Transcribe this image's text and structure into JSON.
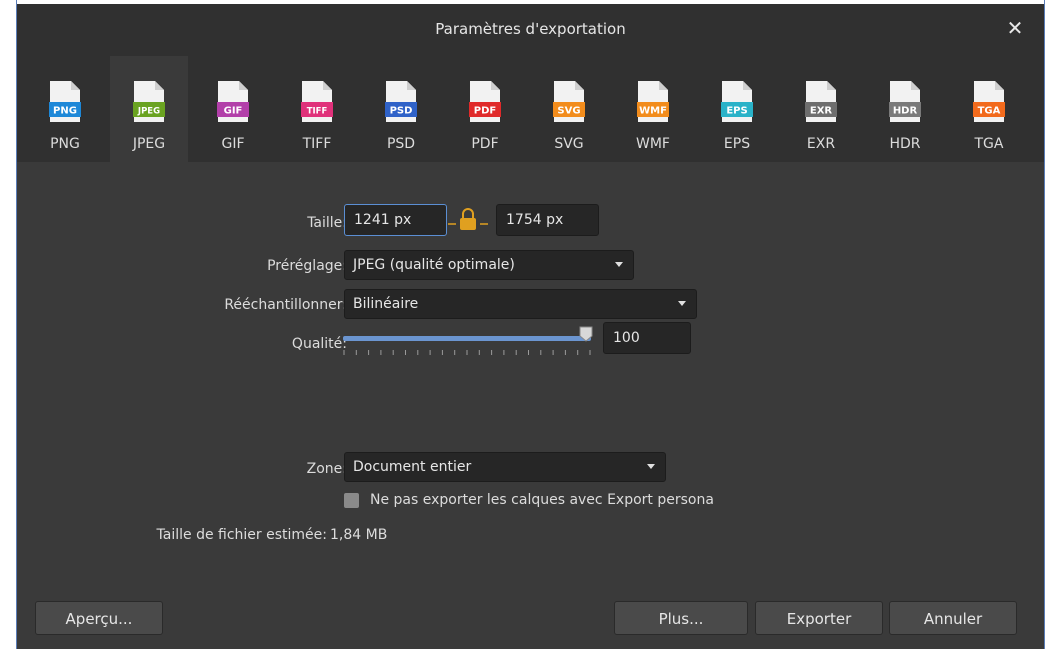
{
  "dialog": {
    "title": "Paramètres d'exportation",
    "close_glyph": "✕"
  },
  "formats": [
    {
      "badge": "PNG",
      "label": "PNG",
      "color": "#1e88d8",
      "fold": "#1e88d8"
    },
    {
      "badge": "JPEG",
      "label": "JPEG",
      "color": "#6aa321",
      "fold": "#ffffff",
      "active": true
    },
    {
      "badge": "GIF",
      "label": "GIF",
      "color": "#b23fa9",
      "fold": "#ffffff"
    },
    {
      "badge": "TIFF",
      "label": "TIFF",
      "color": "#e0317a",
      "fold": "#ffffff"
    },
    {
      "badge": "PSD",
      "label": "PSD",
      "color": "#2f62c8",
      "fold": "#2f62c8"
    },
    {
      "badge": "PDF",
      "label": "PDF",
      "color": "#e02a2a",
      "fold": "#e02a2a"
    },
    {
      "badge": "SVG",
      "label": "SVG",
      "color": "#f28c1c",
      "fold": "#f28c1c"
    },
    {
      "badge": "WMF",
      "label": "WMF",
      "color": "#f28c1c",
      "fold": "#f28c1c"
    },
    {
      "badge": "EPS",
      "label": "EPS",
      "color": "#2ab2c8",
      "fold": "#2ab2c8"
    },
    {
      "badge": "EXR",
      "label": "EXR",
      "color": "#6e6e6e",
      "fold": "#6e6e6e"
    },
    {
      "badge": "HDR",
      "label": "HDR",
      "color": "#7a7a7a",
      "fold": "#ffffff"
    },
    {
      "badge": "TGA",
      "label": "TGA",
      "color": "#f26a1c",
      "fold": "#ffffff"
    }
  ],
  "settings": {
    "size_label": "Taille:",
    "width_value": "1241 px",
    "height_value": "1754 px",
    "preset_label": "Préréglage:",
    "preset_value": "JPEG (qualité optimale)",
    "resample_label": "Rééchantillonner:",
    "resample_value": "Bilinéaire",
    "quality_label": "Qualité:",
    "quality_value": "100",
    "quality_level": 100,
    "zone_label": "Zone:",
    "zone_value": "Document entier",
    "persona_checkbox_label": "Ne pas exporter les calques avec Export persona",
    "persona_checked": false,
    "filesize_label": "Taille de fichier estimée:",
    "filesize_value": "1,84 MB"
  },
  "buttons": {
    "preview": "Aperçu...",
    "more": "Plus...",
    "export": "Exporter",
    "cancel": "Annuler"
  },
  "colors": {
    "dialog_bg": "#3a3a3a",
    "header_bg": "#303030",
    "accent": "#6b95d0",
    "lock": "#e0a020"
  }
}
